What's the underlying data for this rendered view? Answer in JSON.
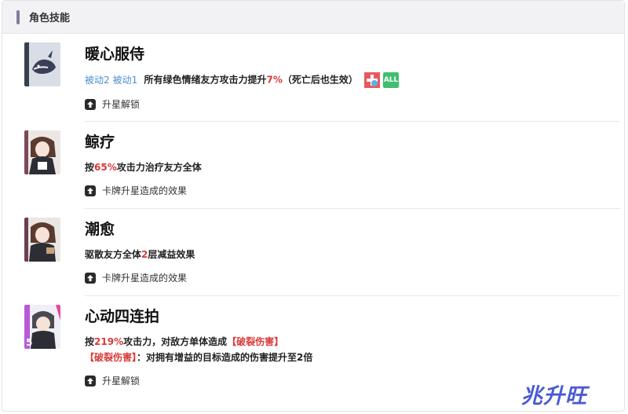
{
  "header": {
    "title": "角色技能"
  },
  "skills": [
    {
      "name": "暖心服侍",
      "tags": [
        "被动2",
        "被动1"
      ],
      "desc_pre": "所有绿色情绪友方攻击力提升",
      "desc_value": "7%",
      "desc_post": "（死亡后也生效）",
      "badges": [
        "heal-badge-icon",
        "ALL"
      ],
      "upgrade": "升星解锁"
    },
    {
      "name": "鲸疗",
      "desc_pre": "按",
      "desc_value": "65%",
      "desc_post": "攻击力治疗友方全体",
      "upgrade": "卡牌升星造成的效果"
    },
    {
      "name": "潮愈",
      "desc_pre": "驱散友方全体",
      "desc_value": "2",
      "desc_post": "层减益效果",
      "upgrade": "卡牌升星造成的效果"
    },
    {
      "name": "心动四连拍",
      "desc_pre": "按",
      "desc_value": "219%",
      "desc_mid": "攻击力，对敌方单体造成",
      "desc_keyword": "【破裂伤害】",
      "line2_keyword": "【破裂伤害】",
      "line2_text": "：对拥有增益的目标造成的伤害提升至2倍",
      "upgrade": "升星解锁"
    }
  ],
  "watermark": "兆升旺",
  "colors": {
    "accent_red": "#d83a3a",
    "tag_blue": "#4a8fd0",
    "header_bg": "#f2f2f4",
    "badge_green": "#3fbf6f",
    "badge_red": "#e85a5a"
  }
}
